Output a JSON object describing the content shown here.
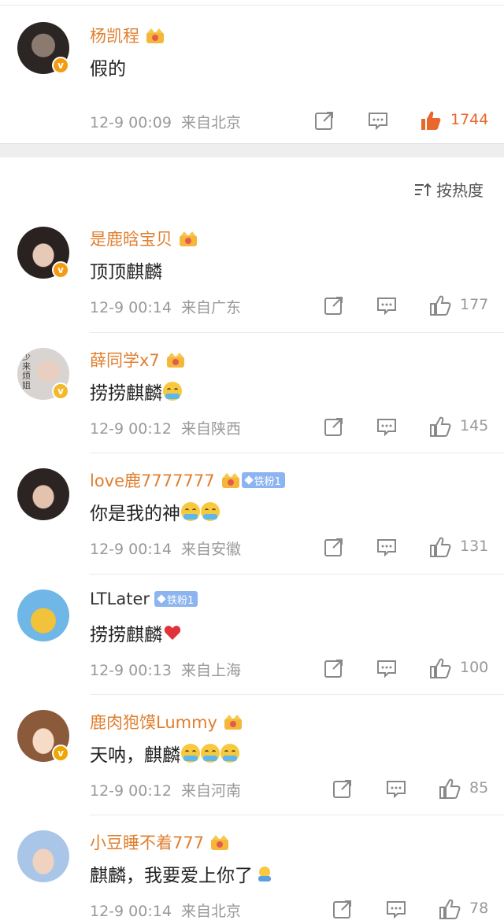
{
  "top_comment": {
    "username": "杨凯程",
    "text": "假的",
    "time": "12-9 00:09",
    "location": "来自北京",
    "likes": "1744"
  },
  "sort_label": "按热度",
  "comments": [
    {
      "username": "是鹿晗宝贝",
      "text": "顶顶麒麟",
      "time": "12-9 00:14",
      "location": "来自广东",
      "likes": "177"
    },
    {
      "username": "薛同学x7",
      "text": "捞捞麒麟",
      "time": "12-9 00:12",
      "location": "来自陕西",
      "likes": "145"
    },
    {
      "username": "love鹿7777777",
      "fan_badge": "铁粉1",
      "text": "你是我的神",
      "time": "12-9 00:14",
      "location": "来自安徽",
      "likes": "131"
    },
    {
      "username": "LTLater",
      "fan_badge": "铁粉1",
      "text": "捞捞麒麟",
      "time": "12-9 00:13",
      "location": "来自上海",
      "likes": "100"
    },
    {
      "username": "鹿肉狍馍Lummy",
      "text": "天呐，麒麟",
      "time": "12-9 00:12",
      "location": "来自河南",
      "likes": "85"
    },
    {
      "username": "小豆睡不着777",
      "text": "麒麟，我要爱上你了",
      "time": "12-9 00:14",
      "location": "来自北京",
      "likes": "78"
    }
  ],
  "avatar_texts": {
    "c2": "少来烦姐"
  },
  "colors": {
    "username": "#e07f2f",
    "accent": "#e8682c",
    "meta": "#999999"
  }
}
